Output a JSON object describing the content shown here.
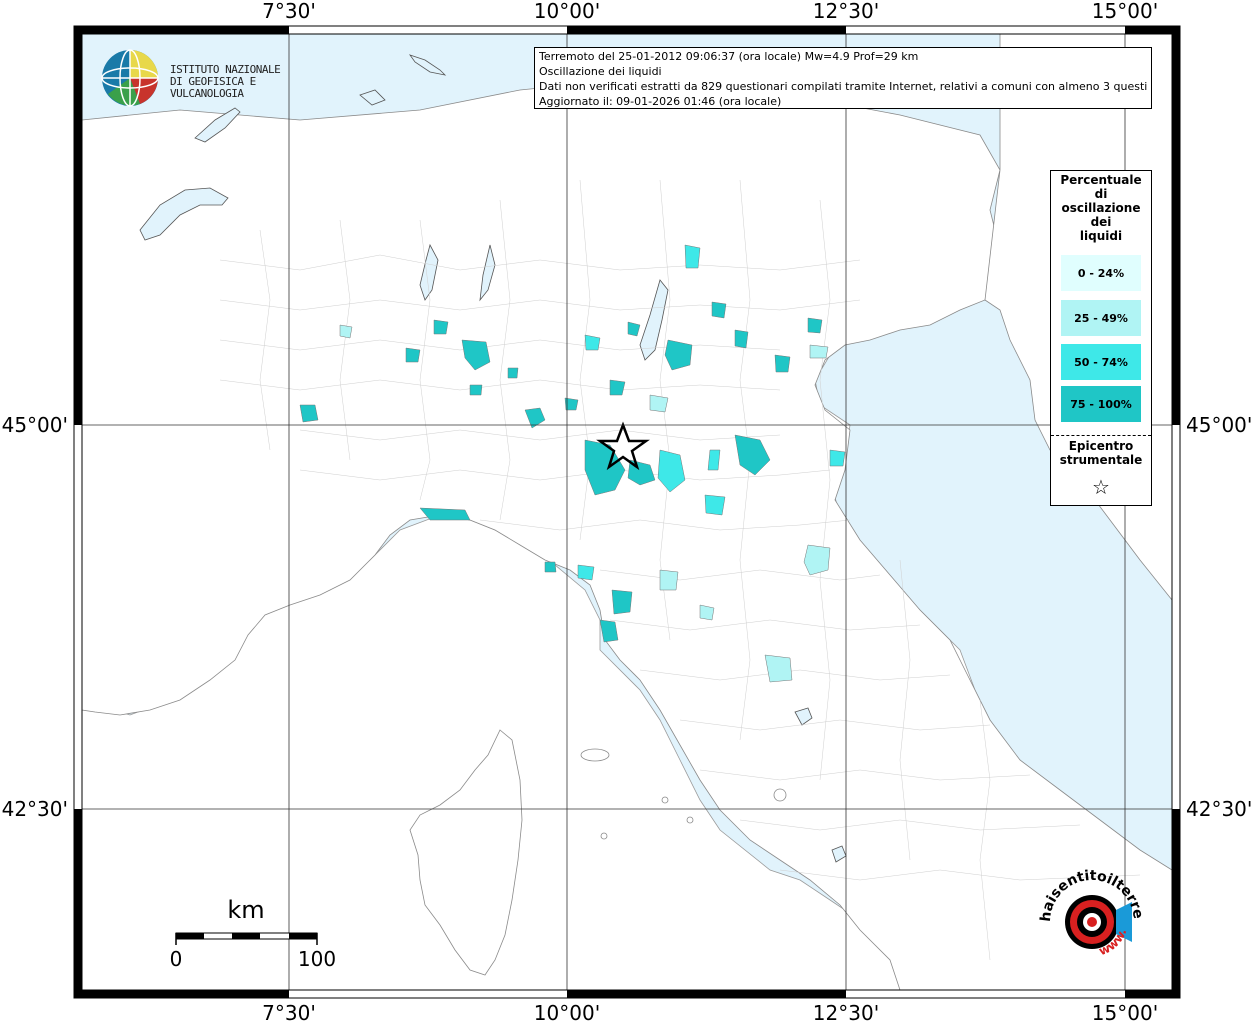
{
  "grid": {
    "top_labels": [
      "7°30'",
      "10°00'",
      "12°30'",
      "15°00'"
    ],
    "bottom_labels": [
      "7°30'",
      "10°00'",
      "12°30'",
      "15°00'"
    ],
    "left_labels": [
      "45°00'",
      "42°30'"
    ],
    "right_labels": [
      "45°00'",
      "42°30'"
    ]
  },
  "info": {
    "line1": "Terremoto del 25-01-2012 09:06:37 (ora locale) Mw=4.9 Prof=29 km",
    "line2": "Oscillazione dei liquidi",
    "line3": "Dati non verificati estratti da 829 questionari compilati tramite Internet, relativi a comuni con almeno 3 questionari.",
    "line4": "Aggiornato il: 09-01-2026 01:46 (ora locale)"
  },
  "logo": {
    "line1": "ISTITUTO NAZIONALE",
    "line2": "DI GEOFISICA E VULCANOLOGIA"
  },
  "legend": {
    "title_lines": [
      "Percentuale",
      "di",
      "oscillazione",
      "dei",
      "liquidi"
    ],
    "items": [
      {
        "label": "0 - 24%",
        "color": "#e0fefe"
      },
      {
        "label": "25 - 49%",
        "color": "#b0f4f4"
      },
      {
        "label": "50 - 74%",
        "color": "#3ee8e8"
      },
      {
        "label": "75 - 100%",
        "color": "#1fc6c6"
      }
    ],
    "epicenter_lines": [
      "Epicentro",
      "strumentale"
    ],
    "star": "☆"
  },
  "scale": {
    "unit": "km",
    "start": "0",
    "end": "100"
  },
  "colors": {
    "sea": "#e1f3fc",
    "land": "#ffffff",
    "border": "#b8b8b8"
  },
  "watermark": {
    "text": "haisentitoilterremoto.it",
    "url_text": "www."
  }
}
